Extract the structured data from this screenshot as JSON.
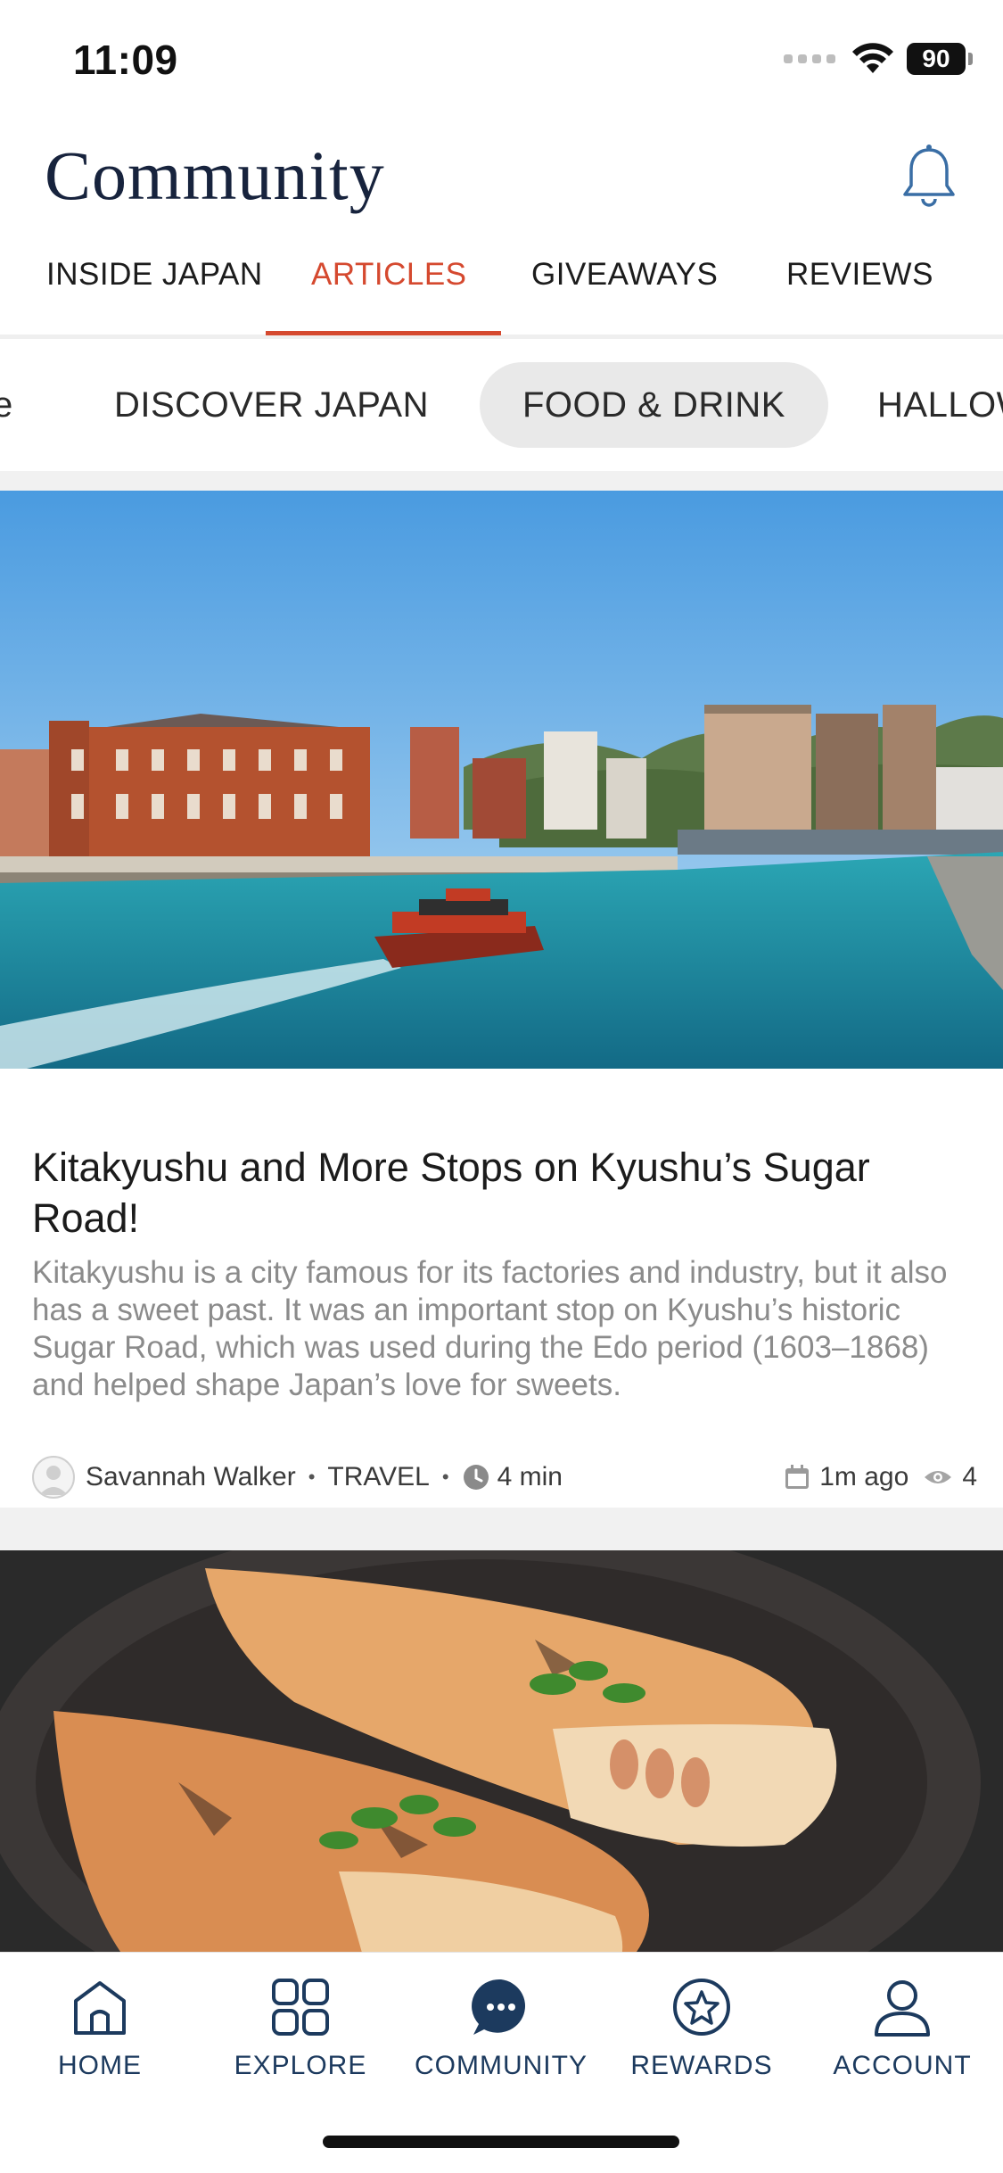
{
  "status_bar": {
    "time": "11:09",
    "battery": "90"
  },
  "header": {
    "title": "Community"
  },
  "tabs": [
    {
      "label": "INSIDE JAPAN",
      "active": false
    },
    {
      "label": "ARTICLES",
      "active": true
    },
    {
      "label": "GIVEAWAYS",
      "active": false
    },
    {
      "label": "REVIEWS",
      "active": false
    }
  ],
  "chips": [
    {
      "label": "e",
      "selected": false
    },
    {
      "label": "DISCOVER JAPAN",
      "selected": false
    },
    {
      "label": "FOOD & DRINK",
      "selected": true
    },
    {
      "label": "HALLOW",
      "selected": false
    }
  ],
  "articles": [
    {
      "title": "Kitakyushu and More Stops on Kyushu’s Sugar Road!",
      "excerpt": "Kitakyushu is a city famous for its factories and industry, but it also has a sweet past. It was an important stop on Kyushu’s historic Sugar Road, which was used during the Edo period (1603–1868) and helped shape Japan’s love for sweets.",
      "author": "Savannah Walker",
      "category": "TRAVEL",
      "read_time": "4 min",
      "posted": "1m ago",
      "views": "4"
    }
  ],
  "bottom_nav": [
    {
      "label": "HOME",
      "icon": "home-icon"
    },
    {
      "label": "EXPLORE",
      "icon": "grid-icon"
    },
    {
      "label": "COMMUNITY",
      "icon": "chat-bubble-icon"
    },
    {
      "label": "REWARDS",
      "icon": "star-icon"
    },
    {
      "label": "ACCOUNT",
      "icon": "user-icon"
    }
  ],
  "colors": {
    "accent": "#d5492f",
    "nav": "#1c3a5e",
    "title": "#17233d"
  }
}
